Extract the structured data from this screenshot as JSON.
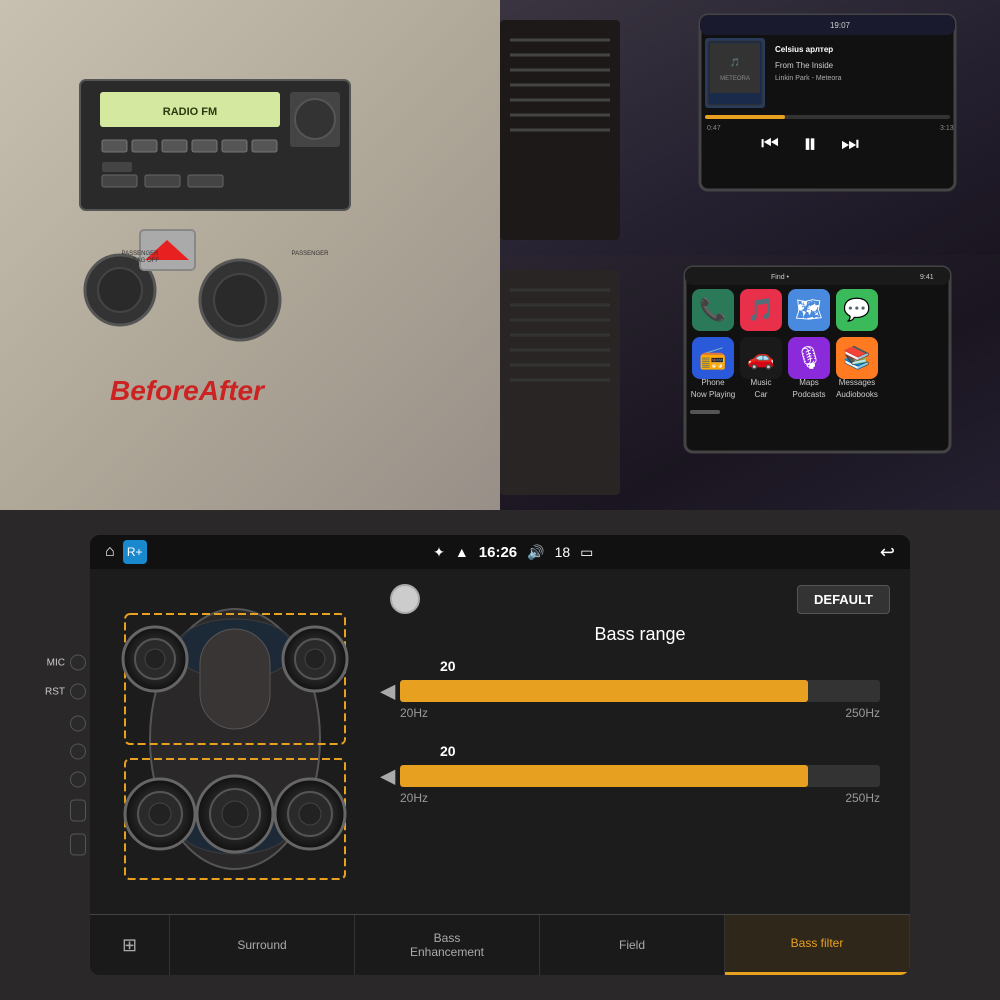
{
  "top_photos": {
    "before_after_label": "BeforeAfter",
    "after_label": "After"
  },
  "status_bar": {
    "mic_label": "MIC",
    "rst_label": "RST",
    "bluetooth_icon": "⚡",
    "wifi_icon": "▲",
    "time": "16:26",
    "volume_icon": "🔊",
    "volume_level": "18",
    "battery_icon": "🔋",
    "back_icon": "↩"
  },
  "bass_filter": {
    "title": "Bass range",
    "default_btn": "DEFAULT",
    "slider1": {
      "value": "20",
      "min_label": "20Hz",
      "max_label": "250Hz",
      "fill_percent": 85
    },
    "slider2": {
      "value": "20",
      "min_label": "20Hz",
      "max_label": "250Hz",
      "fill_percent": 85
    }
  },
  "bottom_nav": {
    "tabs": [
      {
        "label": "⊞",
        "text": "",
        "icon_name": "equalizer-icon",
        "active": false
      },
      {
        "label": "Surround",
        "text": "Surround",
        "icon_name": "surround-tab",
        "active": false
      },
      {
        "label": "Bass\nEnhancement",
        "text": "Bass Enhancement",
        "icon_name": "bass-enhancement-tab",
        "active": false
      },
      {
        "label": "Field",
        "text": "Field",
        "icon_name": "field-tab",
        "active": false
      },
      {
        "label": "Bass filter",
        "text": "Bass filter",
        "icon_name": "bass-filter-tab",
        "active": true
      }
    ]
  },
  "colors": {
    "accent": "#e8a020",
    "background": "#111111",
    "surface": "#1c1c1c",
    "text_primary": "#ffffff",
    "text_secondary": "#999999",
    "active_tab_bg": "#e8a020"
  }
}
